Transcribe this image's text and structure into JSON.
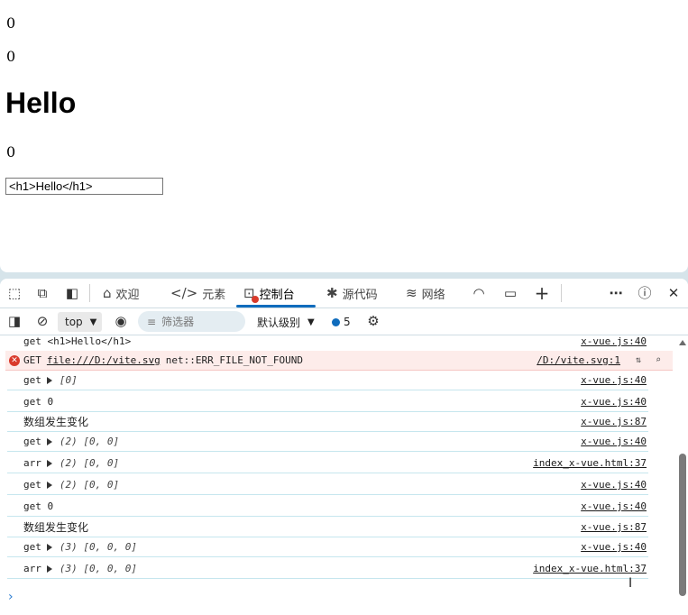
{
  "page": {
    "num1": "0",
    "num2": "0",
    "heading": "Hello",
    "num3": "0",
    "input_value": "<h1>Hello</h1>"
  },
  "devtools": {
    "tabs": [
      {
        "label": "欢迎",
        "icon": "home-icon"
      },
      {
        "label": "元素",
        "icon": "code-brackets-icon"
      },
      {
        "label": "控制台",
        "icon": "console-icon"
      },
      {
        "label": "源代码",
        "icon": "bug-icon"
      },
      {
        "label": "网络",
        "icon": "wifi-icon"
      }
    ],
    "toolbar": {
      "context": "top",
      "filter_placeholder": "筛选器",
      "level": "默认级别",
      "issues_count": "5"
    },
    "console": [
      {
        "type": "log",
        "text": "get <h1>Hello</h1>",
        "source": "x-vue.js:40"
      },
      {
        "type": "error",
        "method": "GET",
        "url": "file:///D:/vite.svg",
        "error": "net::ERR_FILE_NOT_FOUND",
        "source": "/D:/vite.svg:1"
      },
      {
        "type": "log",
        "prefix": "get",
        "expand": true,
        "value": "[0]",
        "source": "x-vue.js:40"
      },
      {
        "type": "log",
        "text": "get 0",
        "source": "x-vue.js:40"
      },
      {
        "type": "log",
        "text": "数组发生变化",
        "source": "x-vue.js:87",
        "cjk": true
      },
      {
        "type": "log",
        "prefix": "get",
        "expand": true,
        "value": "(2) [0, 0]",
        "source": "x-vue.js:40"
      },
      {
        "type": "log",
        "prefix": "arr",
        "expand": true,
        "value": "(2) [0, 0]",
        "source": "index_x-vue.html:37"
      },
      {
        "type": "log",
        "prefix": "get",
        "expand": true,
        "value": "(2) [0, 0]",
        "source": "x-vue.js:40"
      },
      {
        "type": "log",
        "text": "get 0",
        "source": "x-vue.js:40"
      },
      {
        "type": "log",
        "text": "数组发生变化",
        "source": "x-vue.js:87",
        "cjk": true
      },
      {
        "type": "log",
        "prefix": "get",
        "expand": true,
        "value": "(3) [0, 0, 0]",
        "source": "x-vue.js:40"
      },
      {
        "type": "log",
        "prefix": "arr",
        "expand": true,
        "value": "(3) [0, 0, 0]",
        "source": "index_x-vue.html:37"
      }
    ]
  },
  "colors": {
    "accent": "#0f6cbd",
    "error_bg": "#fdecea",
    "error_icon": "#d93a2b",
    "row_border": "#c6e6ee"
  }
}
